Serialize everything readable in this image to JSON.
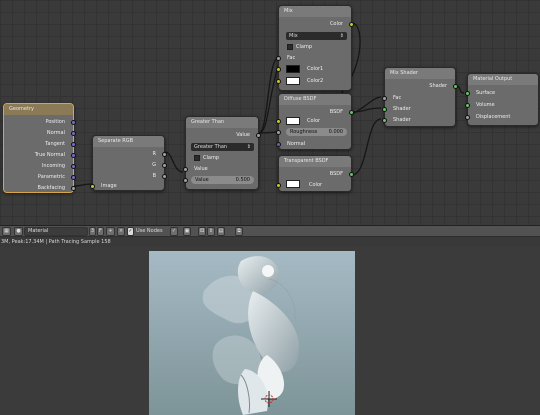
{
  "nodes": {
    "geometry": {
      "title": "Geometry",
      "outputs": [
        "Position",
        "Normal",
        "Tangent",
        "True Normal",
        "Incoming",
        "Parametric",
        "Backfacing"
      ]
    },
    "separate_rgb": {
      "title": "Separate RGB",
      "outputs": [
        "R",
        "G",
        "B"
      ],
      "input": "Image"
    },
    "greater_than": {
      "title": "Greater Than",
      "output": "Value",
      "operation": "Greater Than",
      "clamp_label": "Clamp",
      "input_label": "Value",
      "value_label": "Value",
      "value": "0.500"
    },
    "mix": {
      "title": "Mix",
      "output": "Color",
      "blend_type": "Mix",
      "clamp_label": "Clamp",
      "inputs": [
        "Fac",
        "Color1",
        "Color2"
      ]
    },
    "diffuse": {
      "title": "Diffuse BSDF",
      "output": "BSDF",
      "inputs": [
        "Color",
        "Roughness",
        "Normal"
      ],
      "roughness_label": "Roughness",
      "roughness_value": "0.000"
    },
    "transparent": {
      "title": "Transparent BSDF",
      "output": "BSDF",
      "input": "Color"
    },
    "mix_shader": {
      "title": "Mix Shader",
      "output": "Shader",
      "inputs": [
        "Fac",
        "Shader",
        "Shader"
      ]
    },
    "material_output": {
      "title": "Material Output",
      "inputs": [
        "Surface",
        "Volume",
        "Displacement"
      ]
    }
  },
  "header": {
    "material_label": "Material",
    "users": "3",
    "fake_user": "F",
    "use_nodes_label": "Use Nodes"
  },
  "status": {
    "text": "3M, Peak:17.34M | Path Tracing Sample 158"
  },
  "colors": {
    "node_editor_bg": "#3a3a3a",
    "node_body": "#6b6b6b",
    "selected_border": "#d7a54a",
    "wire": "#161616",
    "render_bg_top": "#a6bac5",
    "render_bg_bottom": "#7d9498"
  },
  "icons": [
    "node-editor-icon",
    "sphere-icon",
    "checkbox-icon",
    "pin-icon",
    "lock-icon",
    "snap-icon"
  ]
}
